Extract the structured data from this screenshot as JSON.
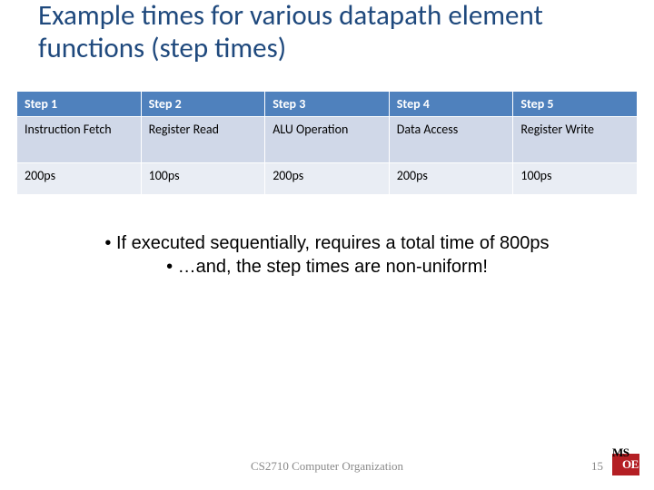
{
  "title": "Example times for various datapath element functions (step times)",
  "table": {
    "headers": [
      "Step 1",
      "Step 2",
      "Step 3",
      "Step 4",
      "Step 5"
    ],
    "rows": [
      [
        "Instruction Fetch",
        "Register Read",
        "ALU Operation",
        "Data Access",
        "Register Write"
      ],
      [
        "200ps",
        "100ps",
        "200ps",
        "200ps",
        "100ps"
      ]
    ]
  },
  "bullets": {
    "line1": "• If executed sequentially, requires a total time of 800ps",
    "line2": "• …and, the step times are non-uniform!"
  },
  "footer": {
    "course": "CS2710 Computer Organization",
    "page": "15"
  },
  "logo": {
    "top": "MS",
    "bot": "OE"
  },
  "chart_data": {
    "type": "table",
    "title": "Example times for various datapath element functions (step times)",
    "columns": [
      "Step 1",
      "Step 2",
      "Step 3",
      "Step 4",
      "Step 5"
    ],
    "operation_row": [
      "Instruction Fetch",
      "Register Read",
      "ALU Operation",
      "Data Access",
      "Register Write"
    ],
    "time_row_ps": [
      200,
      100,
      200,
      200,
      100
    ],
    "total_time_ps": 800
  }
}
